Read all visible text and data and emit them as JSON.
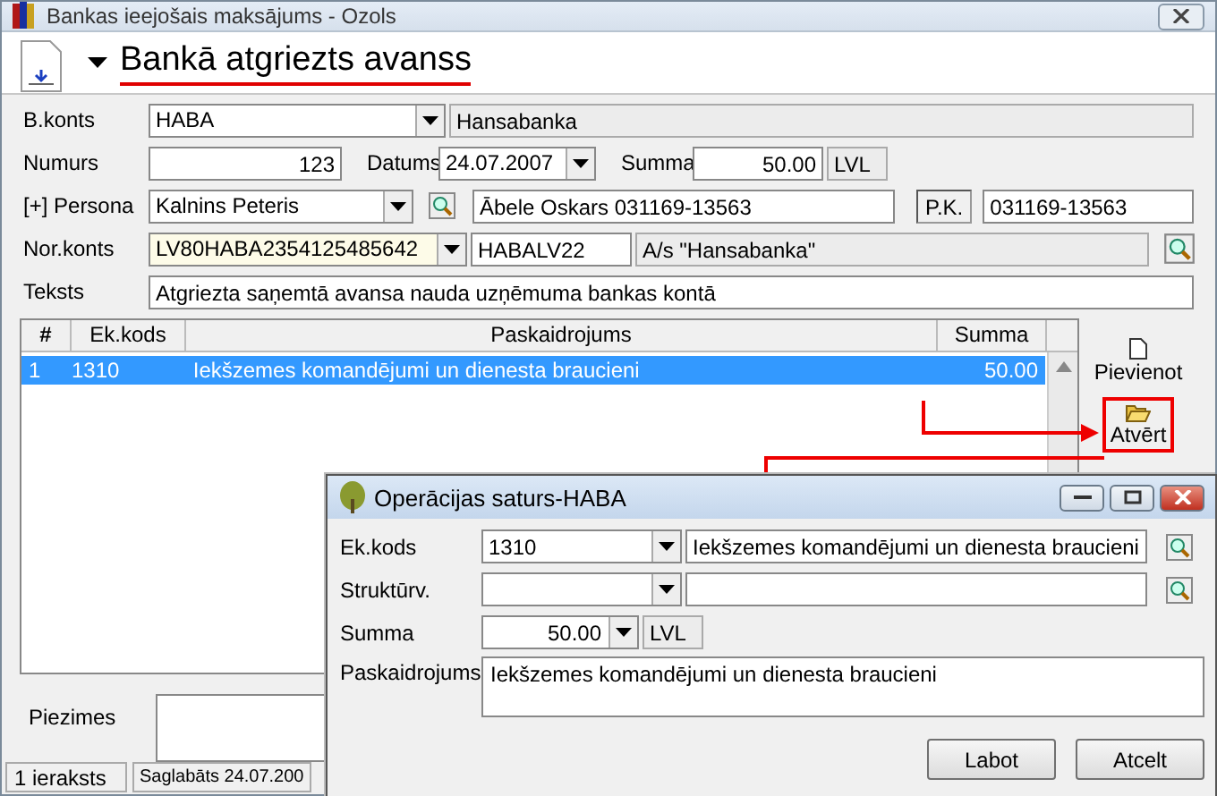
{
  "window": {
    "title": "Bankas ieejošais maksājums - Ozols"
  },
  "header": {
    "title": "Bankā atgriezts avanss"
  },
  "form": {
    "bank_account": {
      "label": "B.konts",
      "value": "HABA",
      "name": "Hansabanka"
    },
    "number": {
      "label": "Numurs",
      "value": "123"
    },
    "date": {
      "label": "Datums",
      "value": "24.07.2007"
    },
    "amount": {
      "label": "Summa",
      "value": "50.00",
      "currency": "LVL"
    },
    "person": {
      "label": "[+] Persona",
      "value": "Kalnins Peteris",
      "name": "Ābele Oskars 031169-13563",
      "code_label": "P.K.",
      "code": "031169-13563"
    },
    "counter_account": {
      "label": "Nor.konts",
      "value": "LV80HABA2354125485642",
      "swift": "HABALV22",
      "bank": "A/s \"Hansabanka\""
    },
    "text": {
      "label": "Teksts",
      "value": "Atgriezta saņemtā avansa nauda uzņēmuma bankas kontā"
    }
  },
  "table": {
    "columns": [
      "#",
      "Ek.kods",
      "Paskaidrojums",
      "Summa"
    ],
    "rows": [
      {
        "cells": [
          "1",
          "1310",
          "Iekšzemes komandējumi un dienesta braucieni",
          "50.00"
        ],
        "selected": true
      }
    ]
  },
  "side_buttons": [
    {
      "label": "Pievienot",
      "kind": "add",
      "highlighted": false
    },
    {
      "label": "Atvērt",
      "kind": "open",
      "highlighted": true
    }
  ],
  "notes": {
    "label": "Piezimes"
  },
  "status_bar": [
    "1 ieraksts",
    "Saglabāts 24.07.200"
  ],
  "dialog": {
    "title": "Operācijas saturs-HABA",
    "fields": [
      {
        "kind": "lookup",
        "label": "Ek.kods",
        "value": "1310",
        "name": "Iekšzemes komandējumi un dienesta braucieni"
      },
      {
        "kind": "lookup",
        "label": "Struktūrv."
      },
      {
        "kind": "amount",
        "label": "Summa",
        "value": "50.00",
        "currency": "LVL"
      },
      {
        "kind": "memo",
        "label": "Paskaidrojums",
        "value": "Iekšzemes komandējumi un dienesta braucieni"
      }
    ],
    "buttons": [
      "Labot",
      "Atcelt"
    ]
  }
}
